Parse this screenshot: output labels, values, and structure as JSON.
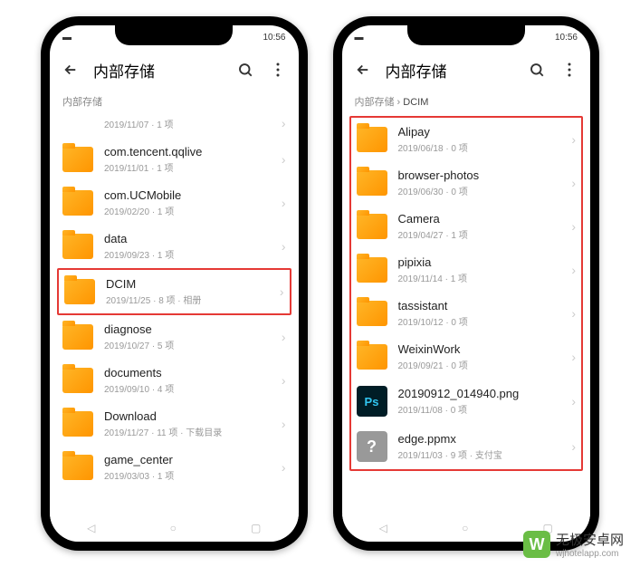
{
  "status_time": "10:56",
  "phone1": {
    "title": "内部存储",
    "breadcrumb": "内部存储",
    "items": [
      {
        "type": "folder",
        "name": "",
        "meta": "2019/11/07 · 1 项",
        "partial": true
      },
      {
        "type": "folder",
        "name": "com.tencent.qqlive",
        "meta": "2019/11/01 · 1 项"
      },
      {
        "type": "folder",
        "name": "com.UCMobile",
        "meta": "2019/02/20 · 1 项"
      },
      {
        "type": "folder",
        "name": "data",
        "meta": "2019/09/23 · 1 项"
      },
      {
        "type": "folder",
        "name": "DCIM",
        "meta": "2019/11/25 · 8 项 · 相册",
        "highlight": true
      },
      {
        "type": "folder",
        "name": "diagnose",
        "meta": "2019/10/27 · 5 项"
      },
      {
        "type": "folder",
        "name": "documents",
        "meta": "2019/09/10 · 4 项"
      },
      {
        "type": "folder",
        "name": "Download",
        "meta": "2019/11/27 · 11 项 · 下载目录"
      },
      {
        "type": "folder",
        "name": "game_center",
        "meta": "2019/03/03 · 1 项"
      }
    ]
  },
  "phone2": {
    "title": "内部存储",
    "breadcrumb_parent": "内部存储",
    "breadcrumb_current": "DCIM",
    "items": [
      {
        "type": "folder",
        "name": "Alipay",
        "meta": "2019/06/18 · 0 项"
      },
      {
        "type": "folder",
        "name": "browser-photos",
        "meta": "2019/06/30 · 0 项"
      },
      {
        "type": "folder",
        "name": "Camera",
        "meta": "2019/04/27 · 1 项"
      },
      {
        "type": "folder",
        "name": "pipixia",
        "meta": "2019/11/14 · 1 项"
      },
      {
        "type": "folder",
        "name": "tassistant",
        "meta": "2019/10/12 · 0 项"
      },
      {
        "type": "folder",
        "name": "WeixinWork",
        "meta": "2019/09/21 · 0 项"
      },
      {
        "type": "ps",
        "name": "20190912_014940.png",
        "meta": "2019/11/08 · 0 项"
      },
      {
        "type": "q",
        "name": "edge.ppmx",
        "meta": "2019/11/03 · 9 项 · 支付宝"
      }
    ]
  },
  "watermark": {
    "logo": "W",
    "text": "无极安卓网",
    "url": "wjhotelapp.com"
  }
}
